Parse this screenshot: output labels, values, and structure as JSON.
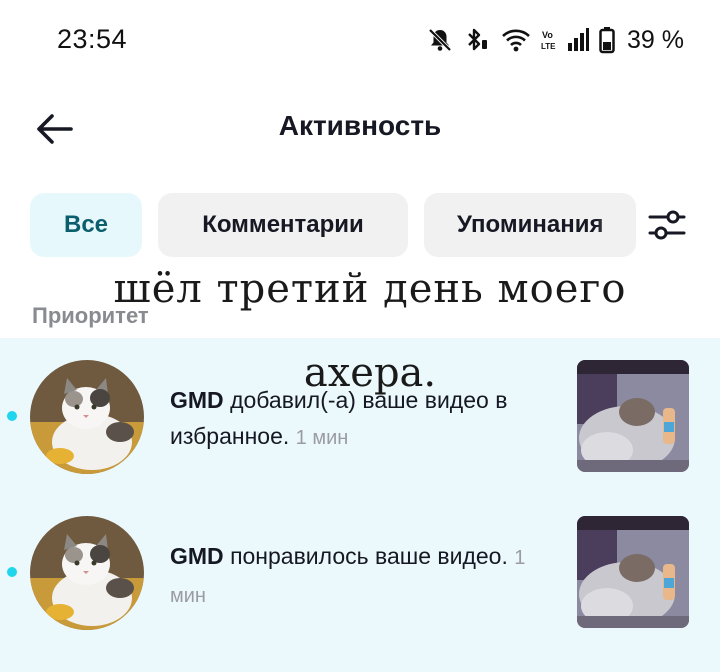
{
  "status_bar": {
    "time": "23:54",
    "battery": "39 %",
    "icons": [
      "bell-muted-icon",
      "bluetooth-icon",
      "wifi-icon",
      "volte-icon",
      "signal-icon",
      "battery-icon"
    ]
  },
  "header": {
    "back_icon": "arrow-left-icon",
    "title": "Активность"
  },
  "tabs": [
    {
      "label": "Все",
      "active": true
    },
    {
      "label": "Комментарии",
      "active": false
    },
    {
      "label": "Упоминания",
      "active": false
    }
  ],
  "filter_icon": "sliders-icon",
  "section": {
    "label": "Приоритет"
  },
  "notifications": [
    {
      "user": "GMD",
      "text": "добавил(-а) ваше видео в избранное.",
      "time": "1 мин",
      "unread": true
    },
    {
      "user": "GMD",
      "text": "понравилось ваше видео.",
      "time": "1 мин",
      "unread": true
    }
  ],
  "overlay": {
    "line1": "шёл третий день моего",
    "line2": "ахера."
  },
  "colors": {
    "accent": "#20d5ec",
    "active_tab_bg": "#e6f8fb",
    "active_tab_text": "#0b5f6d",
    "priority_bg": "#ebf9fc"
  }
}
